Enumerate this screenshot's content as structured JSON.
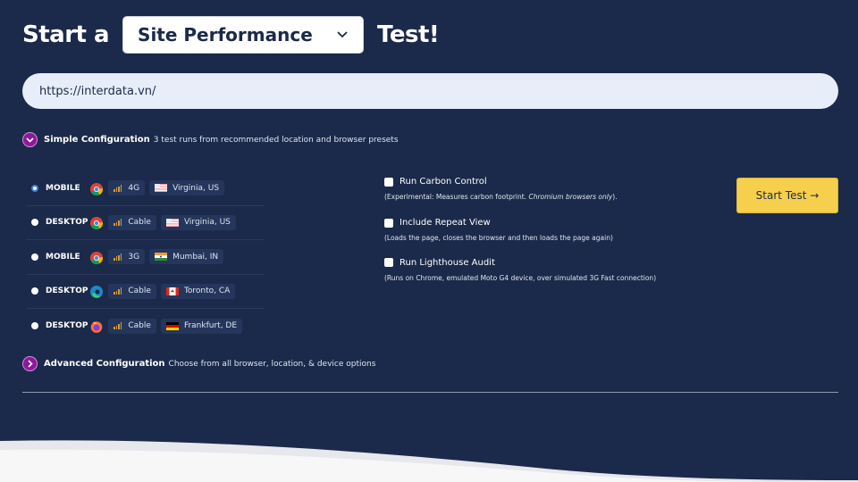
{
  "heading": {
    "lead": "Start a",
    "test_type": "Site Performance",
    "tail": "Test!"
  },
  "url_input": {
    "value": "https://interdata.vn/"
  },
  "simple_config": {
    "title": "Simple Configuration",
    "desc": "3 test runs from recommended location and browser presets"
  },
  "runs": [
    {
      "selected": true,
      "device": "MOBILE",
      "browser": "chrome",
      "connection": "4G",
      "location": "Virginia, US",
      "flag": "us"
    },
    {
      "selected": false,
      "device": "DESKTOP",
      "browser": "chrome",
      "connection": "Cable",
      "location": "Virginia, US",
      "flag": "us"
    },
    {
      "selected": false,
      "device": "MOBILE",
      "browser": "chrome",
      "connection": "3G",
      "location": "Mumbai, IN",
      "flag": "in"
    },
    {
      "selected": false,
      "device": "DESKTOP",
      "browser": "edge",
      "connection": "Cable",
      "location": "Toronto, CA",
      "flag": "ca"
    },
    {
      "selected": false,
      "device": "DESKTOP",
      "browser": "firefox",
      "connection": "Cable",
      "location": "Frankfurt, DE",
      "flag": "de"
    }
  ],
  "options": [
    {
      "label": "Run Carbon Control",
      "desc": "(Experimental: Measures carbon footprint. ",
      "desc_em": "Chromium browsers only",
      "desc_tail": ").",
      "checked": false
    },
    {
      "label": "Include Repeat View",
      "desc": "(Loads the page, closes the browser and then loads the page again)",
      "desc_em": "",
      "desc_tail": "",
      "checked": false
    },
    {
      "label": "Run Lighthouse Audit",
      "desc": "(Runs on Chrome, emulated Moto G4 device, over simulated 3G Fast connection)",
      "desc_em": "",
      "desc_tail": "",
      "checked": false
    }
  ],
  "start_button": {
    "label": "Start Test →"
  },
  "advanced_config": {
    "title": "Advanced Configuration",
    "desc": "Choose from all browser, location, & device options"
  },
  "colors": {
    "background": "#1b2a4a",
    "accent_button": "#f6d04d",
    "toggle_purple": "#8a1a9a"
  }
}
